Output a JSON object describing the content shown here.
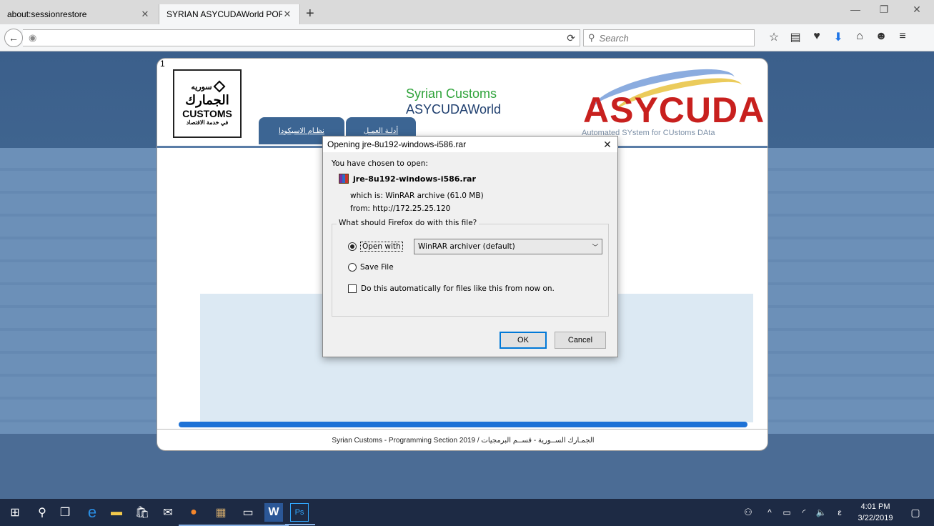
{
  "browser": {
    "tabs": [
      {
        "title": "about:sessionrestore"
      },
      {
        "title": "SYRIAN ASYCUDAWorld PORT..."
      }
    ],
    "search_placeholder": "Search",
    "url": ""
  },
  "portal": {
    "page_number": "1",
    "logo_top": "سوريه",
    "logo_ar": "الجمارك",
    "logo_en": "CUSTOMS",
    "logo_sub": "في خدمة الاقتصاد",
    "title": "Syrian Customs",
    "subtitle": "ASYCUDAWorld",
    "nav_tabs": [
      "نظـام الاسيكودا",
      "أدلـة العمـل"
    ],
    "asycuda_logo": "ASYCUDA",
    "asycuda_tagline": "Automated SYstem for CUstoms DAta",
    "footer": "Syrian Customs - Programming Section 2019 / الجمـارك الســورية - قســم البرمجيات"
  },
  "dialog": {
    "title": "Opening jre-8u192-windows-i586.rar",
    "intro": "You have chosen to open:",
    "filename": "jre-8u192-windows-i586.rar",
    "which_is_label": "which is:",
    "which_is_value": "WinRAR archive (61.0 MB)",
    "from_label": "from:",
    "from_value": "http://172.25.25.120",
    "question": "What should Firefox do with this file?",
    "open_with_label": "Open with",
    "open_with_app": "WinRAR archiver (default)",
    "save_file_label": "Save File",
    "auto_label": "Do this automatically for files like this from now on.",
    "ok_label": "OK",
    "cancel_label": "Cancel",
    "selected_option": "open_with",
    "auto_checked": false
  },
  "taskbar": {
    "time": "4:01 PM",
    "date": "3/22/2019",
    "lang": "ε"
  }
}
